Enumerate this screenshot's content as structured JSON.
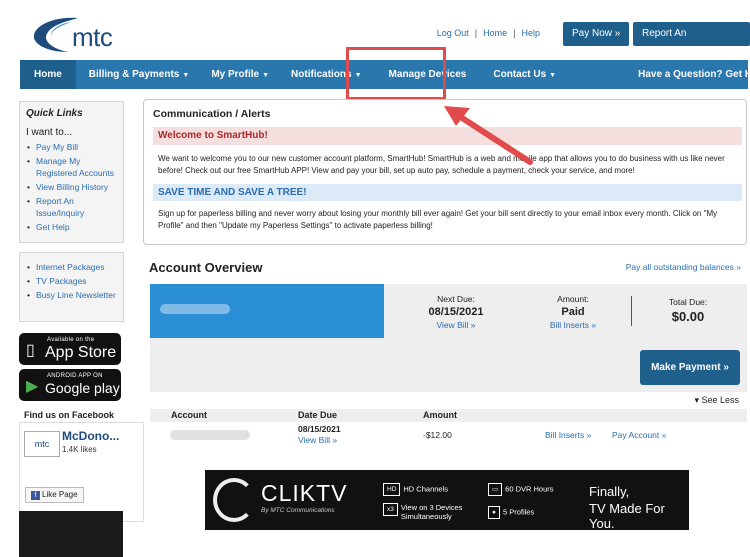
{
  "header": {
    "logo_text": "mtc",
    "links": [
      "Log Out",
      "Home",
      "Help"
    ],
    "pay_now": "Pay Now »",
    "report_issue": "Report An Issue/Inquiry"
  },
  "nav": {
    "home": "Home",
    "billing": "Billing & Payments",
    "profile": "My Profile",
    "notifications": "Notifications",
    "devices": "Manage Devices",
    "contact": "Contact Us",
    "help": "Have a Question? Get Help. »",
    "caret": "▼"
  },
  "sidebar": {
    "quick_title": "Quick Links",
    "i_want": "I want to...",
    "quick_links": [
      "Pay My Bill",
      "Manage My Registered Accounts",
      "View Billing History",
      "Report An Issue/Inquiry",
      "Get Help"
    ],
    "more_links": [
      "Internet Packages",
      "TV Packages",
      "Busy Line Newsletter"
    ],
    "app_store_small": "Available on the",
    "app_store_big": "App Store",
    "google_small": "ANDROID APP ON",
    "google_big": "Google play",
    "fb_title": "Find us on Facebook",
    "fb_name": "McDono...",
    "fb_likes": "1.4K likes",
    "fb_like_page": "Like Page",
    "fb_logo": "mtc"
  },
  "communication": {
    "title": "Communication / Alerts",
    "welcome_heading": "Welcome to SmartHub!",
    "welcome_text": "We want to welcome you to our new customer account platform, SmartHub! SmartHub is a web and mobile app that allows you to do business with us like never before! Check out our free SmartHub APP! View and pay your bill, set up auto pay, schedule a payment, check your service, and more!",
    "save_heading": "SAVE TIME AND SAVE A TREE!",
    "save_text": "Sign up for paperless billing and never worry about losing your monthly bill ever again! Get your bill sent directly to your email inbox every month. Click on \"My Profile\" and then \"Update my Paperless Settings\" to activate paperless billing!"
  },
  "account": {
    "title": "Account Overview",
    "pay_all": "Pay all outstanding balances »",
    "next_due_label": "Next Due:",
    "next_due": "08/15/2021",
    "view_bill": "View Bill »",
    "amount_label": "Amount:",
    "amount_status": "Paid",
    "bill_inserts": "Bill Inserts »",
    "total_due_label": "Total Due:",
    "total_due": "$0.00",
    "make_payment": "Make Payment »",
    "see_less": "▾ See Less",
    "table_headers": [
      "Account",
      "Date Due",
      "Amount"
    ],
    "row": {
      "date_due": "08/15/2021",
      "view_bill": "View Bill »",
      "amount": "-$12.00",
      "bill_inserts": "Bill Inserts »",
      "pay_account": "Pay Account »"
    }
  },
  "banner": {
    "brand": "CLIKTV",
    "by": "By MTC Communications",
    "hd_icon": "HD",
    "hd_text": "HD Channels",
    "x3_icon": "x3",
    "x3_text": "View on 3 Devices Simultaneously",
    "dvr_text": "60 DVR Hours",
    "profiles_text": "5 Profiles",
    "tag1": "Finally,",
    "tag2": "TV Made For You."
  }
}
